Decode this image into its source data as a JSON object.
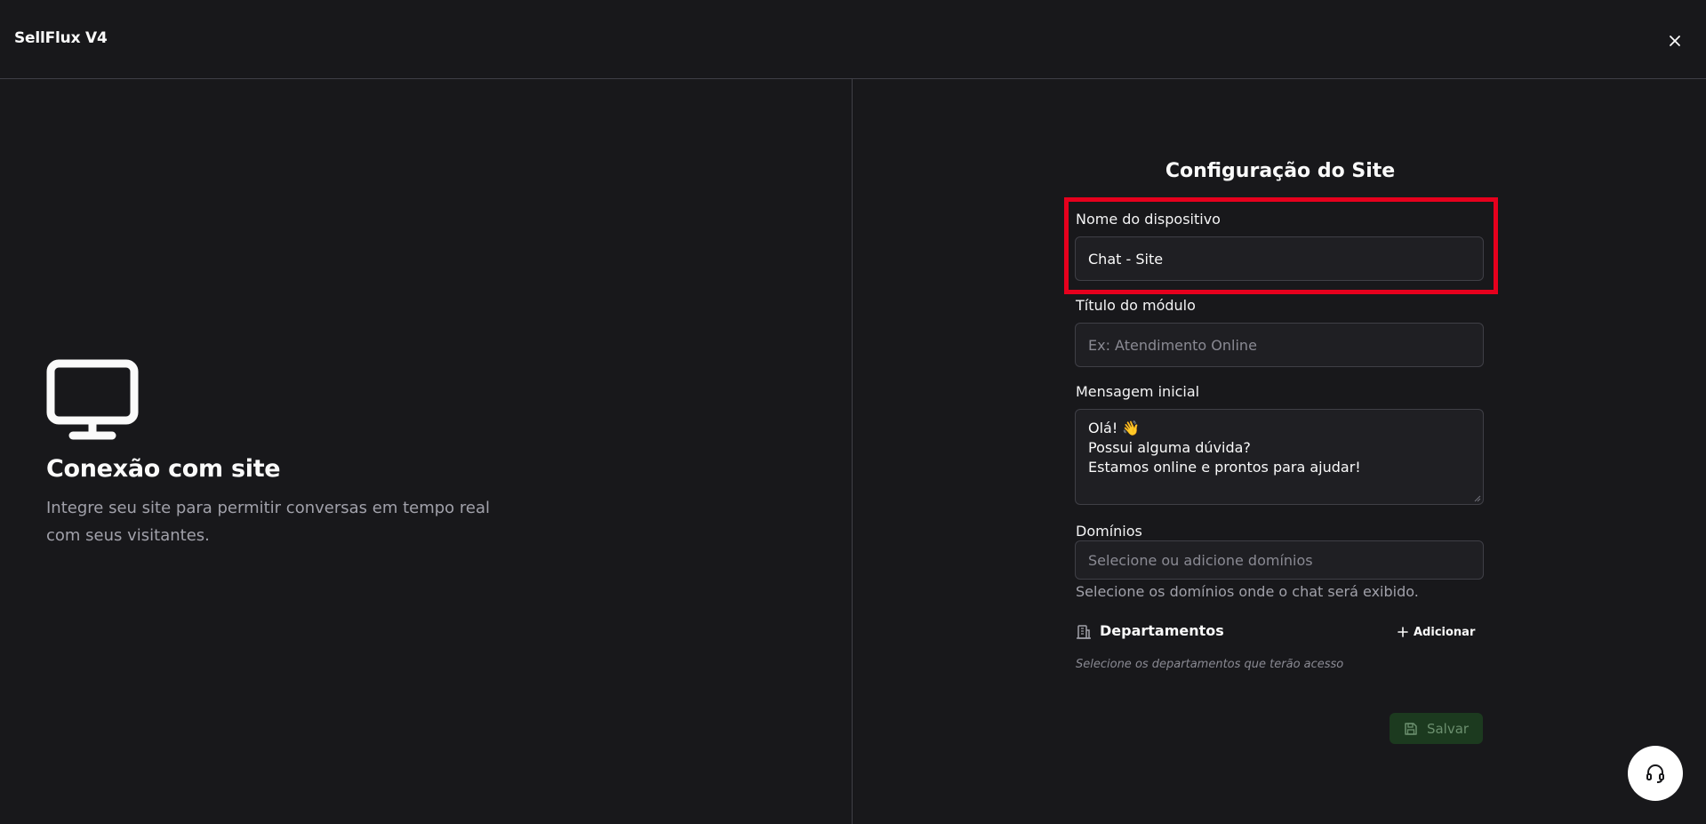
{
  "header": {
    "brand": "SellFlux V4",
    "close_icon": "close-icon"
  },
  "hero": {
    "icon": "monitor-icon",
    "title": "Conexão com site",
    "description": "Integre seu site para permitir conversas em tempo real com seus visitantes."
  },
  "form": {
    "title": "Configuração do Site",
    "device_name": {
      "label": "Nome do dispositivo",
      "value": "Chat - Site"
    },
    "module_title": {
      "label": "Título do módulo",
      "value": "",
      "placeholder": "Ex: Atendimento Online"
    },
    "initial_message": {
      "label": "Mensagem inicial",
      "lines": [
        "Olá! 👋",
        "Possui alguma dúvida?",
        "Estamos online e prontos para ajudar!"
      ]
    },
    "domains": {
      "label": "Domínios",
      "placeholder": "Selecione ou adicione domínios",
      "helper": "Selecione os domínios onde o chat será exibido."
    },
    "departments": {
      "icon": "building-icon",
      "title": "Departamentos",
      "add_label": "Adicionar",
      "hint": "Selecione os departamentos que terão acesso"
    },
    "save_label": "Salvar"
  },
  "support": {
    "icon": "headset-icon"
  },
  "colors": {
    "background": "#18181b",
    "highlight": "#e6001d",
    "save_bg": "#1c3a1f",
    "save_text": "#6b8f6e"
  }
}
